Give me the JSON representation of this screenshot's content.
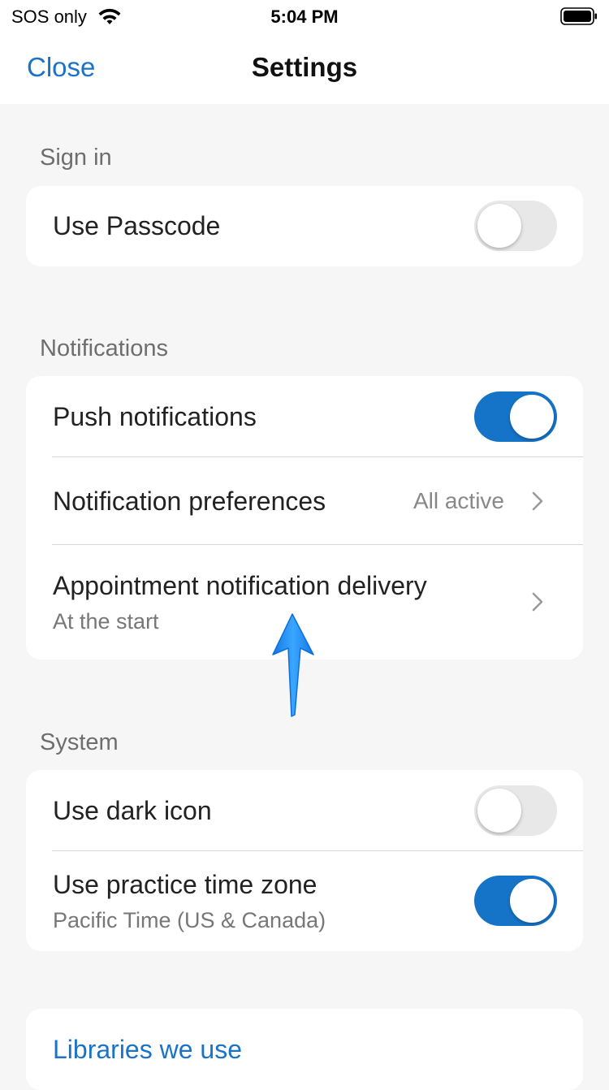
{
  "status_bar": {
    "carrier": "SOS only",
    "time": "5:04 PM"
  },
  "nav": {
    "close_label": "Close",
    "title": "Settings"
  },
  "sections": {
    "sign_in": {
      "header": "Sign in",
      "use_passcode": {
        "label": "Use Passcode",
        "enabled": false
      }
    },
    "notifications": {
      "header": "Notifications",
      "push": {
        "label": "Push notifications",
        "enabled": true
      },
      "preferences": {
        "label": "Notification preferences",
        "value": "All active"
      },
      "appointment": {
        "label": "Appointment notification delivery",
        "subtitle": "At the start"
      }
    },
    "system": {
      "header": "System",
      "dark_icon": {
        "label": "Use dark icon",
        "enabled": false
      },
      "practice_tz": {
        "label": "Use practice time zone",
        "subtitle": "Pacific Time (US & Canada)",
        "enabled": true
      }
    },
    "about": {
      "libraries_label": "Libraries we use"
    }
  },
  "colors": {
    "accent": "#1a73c8",
    "toggle_on": "#1674c8",
    "toggle_off": "#e8e8e8",
    "background": "#f6f6f6",
    "annotation_arrow": "#1e90ff"
  },
  "icons": [
    "wifi-icon",
    "battery-icon",
    "chevron-right-icon",
    "up-arrow-annotation"
  ]
}
